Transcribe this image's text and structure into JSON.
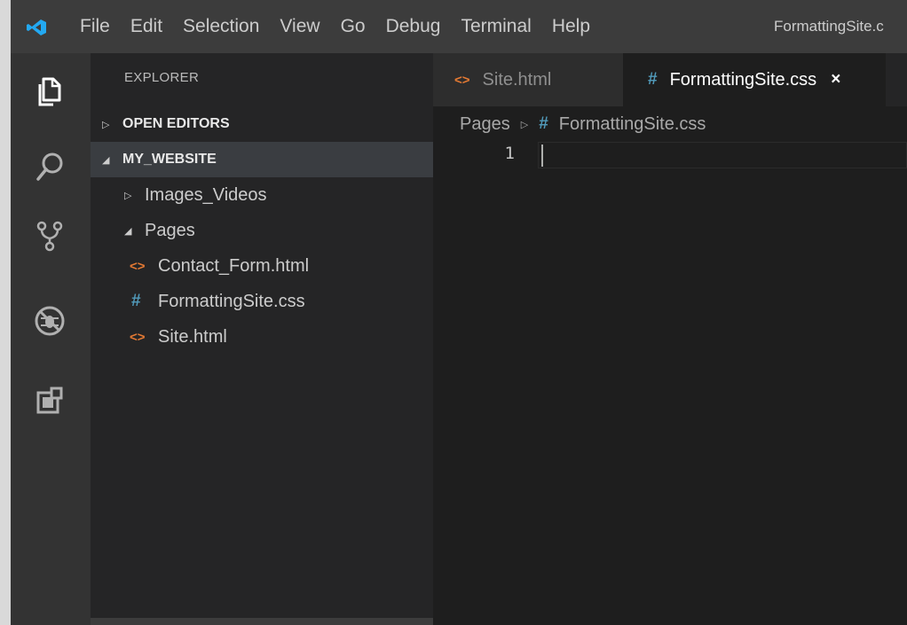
{
  "menu": {
    "items": [
      "File",
      "Edit",
      "Selection",
      "View",
      "Go",
      "Debug",
      "Terminal",
      "Help"
    ],
    "window_title": "FormattingSite.c"
  },
  "activity_bar": {
    "icons": [
      "explorer-icon",
      "search-icon",
      "source-control-icon",
      "debug-icon",
      "extensions-icon"
    ]
  },
  "sidebar": {
    "title": "EXPLORER",
    "open_editors_label": "OPEN EDITORS",
    "project_label": "MY_WEBSITE",
    "tree": [
      {
        "label": "Images_Videos",
        "kind": "folder",
        "expanded": false
      },
      {
        "label": "Pages",
        "kind": "folder",
        "expanded": true
      },
      {
        "label": "Contact_Form.html",
        "kind": "html"
      },
      {
        "label": "FormattingSite.css",
        "kind": "css"
      },
      {
        "label": "Site.html",
        "kind": "html"
      }
    ]
  },
  "tabs": [
    {
      "label": "Site.html",
      "icon": "<>",
      "active": false
    },
    {
      "label": "FormattingSite.css",
      "icon": "#",
      "active": true,
      "close": "×"
    }
  ],
  "breadcrumb": {
    "folder": "Pages",
    "icon": "#",
    "file": "FormattingSite.css"
  },
  "editor": {
    "line_number": "1"
  },
  "colors": {
    "html_icon": "#e37933",
    "css_icon": "#519aba",
    "vscode_blue": "#23a9f2"
  }
}
